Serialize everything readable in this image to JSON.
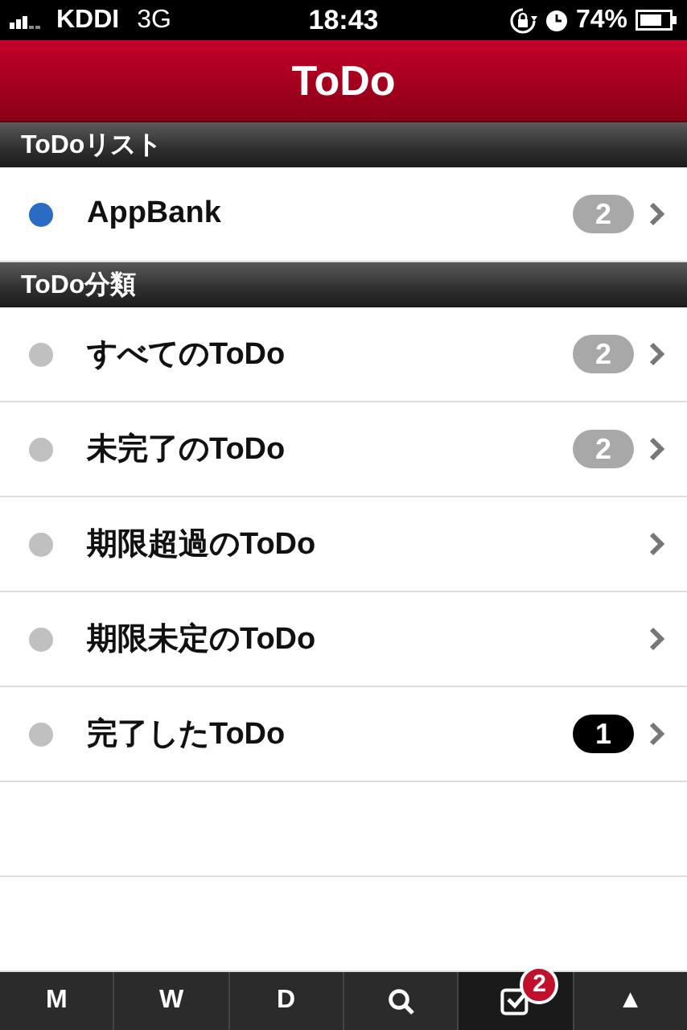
{
  "status_bar": {
    "carrier": "KDDI",
    "network": "3G",
    "time": "18:43",
    "battery": "74%"
  },
  "nav_bar": {
    "title": "ToDo"
  },
  "sections": [
    {
      "header": "ToDoリスト",
      "rows": [
        {
          "label": "AppBank",
          "color": "#2a6cc4",
          "badge": "2",
          "badge_dark": false
        }
      ]
    },
    {
      "header": "ToDo分類",
      "rows": [
        {
          "label": "すべてのToDo",
          "color": "#c0c0c0",
          "badge": "2",
          "badge_dark": false
        },
        {
          "label": "未完了のToDo",
          "color": "#c0c0c0",
          "badge": "2",
          "badge_dark": false
        },
        {
          "label": "期限超過のToDo",
          "color": "#c0c0c0"
        },
        {
          "label": "期限未定のToDo",
          "color": "#c0c0c0"
        },
        {
          "label": "完了したToDo",
          "color": "#c0c0c0",
          "badge": "1",
          "badge_dark": true
        }
      ]
    }
  ],
  "tab_bar": [
    {
      "kind": "text",
      "label": "M",
      "selected": false
    },
    {
      "kind": "text",
      "label": "W",
      "selected": false
    },
    {
      "kind": "text",
      "label": "D",
      "selected": false
    },
    {
      "kind": "search",
      "selected": false
    },
    {
      "kind": "todo",
      "selected": true,
      "badge": "2"
    },
    {
      "kind": "text",
      "label": "▲",
      "selected": false
    }
  ]
}
